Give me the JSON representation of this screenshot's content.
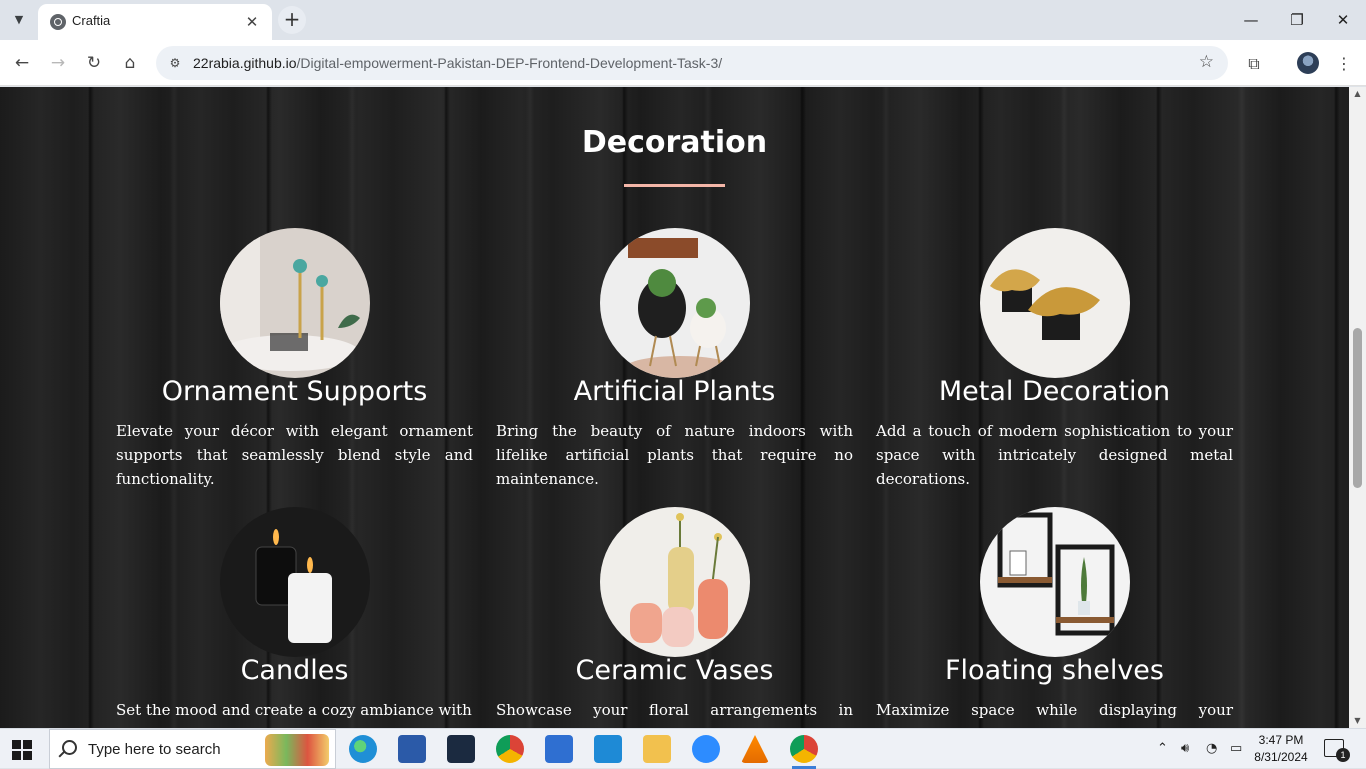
{
  "browser": {
    "tab": {
      "title": "Craftia"
    },
    "new_tab_symbol": "+",
    "url_host": "22rabia.github.io",
    "url_path": "/Digital-empowerment-Pakistan-DEP-Frontend-Development-Task-3/"
  },
  "page": {
    "section_title": "Decoration",
    "colors": {
      "underline": "#f4b6a8",
      "text": "#ffffff",
      "background": "#1c1c1c"
    },
    "cards": [
      {
        "title": "Ornament Supports",
        "description": "Elevate your décor with elegant ornament supports that seamlessly blend style and functionality.",
        "image": "ornament-supports-photo"
      },
      {
        "title": "Artificial Plants",
        "description": "Bring the beauty of nature indoors with lifelike artificial plants that require no maintenance.",
        "image": "artificial-plants-photo"
      },
      {
        "title": "Metal Decoration",
        "description": "Add a touch of modern sophistication to your space with intricately designed metal decorations.",
        "image": "metal-decoration-photo"
      },
      {
        "title": "Candles",
        "description": "Set the mood and create a cozy ambiance with",
        "image": "candles-photo"
      },
      {
        "title": "Ceramic Vases",
        "description": "Showcase your floral arrangements in stunning",
        "image": "ceramic-vases-photo"
      },
      {
        "title": "Floating shelves",
        "description": "Maximize space while displaying your treasures",
        "image": "floating-shelves-photo"
      }
    ]
  },
  "taskbar": {
    "search_placeholder": "Type here to search",
    "apps": [
      "edge-icon",
      "word-icon",
      "dev-icon",
      "chrome-icon",
      "store-icon",
      "vscode-icon",
      "file-explorer-icon",
      "zoom-icon",
      "vlc-icon",
      "chrome-profile-icon"
    ],
    "time": "3:47 PM",
    "date": "8/31/2024",
    "notification_count": "1"
  }
}
